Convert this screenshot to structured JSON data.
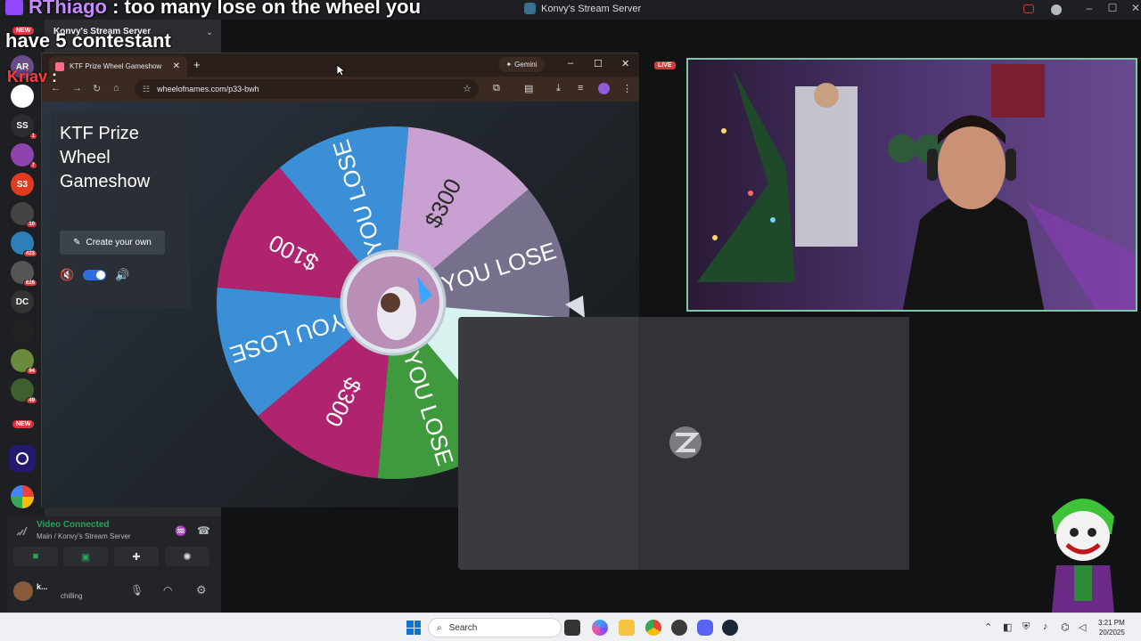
{
  "chat": {
    "username": "RThiago",
    "message_line1": " : too many lose on the wheel you",
    "message_line2": "have 5 contestant",
    "next_username": "Kriav",
    "next_separator": ":"
  },
  "discord": {
    "window_title": "Konvy's Stream Server",
    "server_header": "Konvy's Stream Server",
    "new_badge": "NEW",
    "guilds": [
      {
        "label": "AR",
        "badge": "",
        "color": "#6b4c8a"
      },
      {
        "label": "",
        "badge": "",
        "color": "#ffffff"
      },
      {
        "label": "SS",
        "badge": "1",
        "color": "#2b2d31"
      },
      {
        "label": "",
        "badge": "7",
        "color": "#8e44ad"
      },
      {
        "label": "S3",
        "badge": "",
        "color": "#e03b1f"
      },
      {
        "label": "",
        "badge": "10",
        "color": "#444"
      },
      {
        "label": "",
        "badge": "423",
        "color": "#2c7fb8"
      },
      {
        "label": "",
        "badge": "626",
        "color": "#555"
      },
      {
        "label": "DC",
        "badge": "",
        "color": "#333"
      },
      {
        "label": "",
        "badge": "",
        "color": "#222"
      },
      {
        "label": "",
        "badge": "94",
        "color": "#6a8b3c"
      },
      {
        "label": "",
        "badge": "49",
        "color": "#3f5f2e"
      }
    ],
    "voice": {
      "status": "Video Connected",
      "channel": "Main / Konvy's Stream Server"
    },
    "user": {
      "name": "k...",
      "status": "chilling"
    }
  },
  "browser": {
    "tab_title": "KTF Prize Wheel Gameshow",
    "gemini_label": "Gemini",
    "url": "wheelofnames.com/p33-bwh"
  },
  "wheel_page": {
    "title": "KTF Prize Wheel Gameshow",
    "create_button": "Create your own",
    "segments": [
      "$300",
      "YOU LOSE",
      "$100",
      "YOU LOSE",
      "$300",
      "YOU LOSE",
      "$100",
      "YOU LOSE"
    ]
  },
  "stream": {
    "live_badge": "LIVE"
  },
  "taskbar": {
    "search_placeholder": "Search",
    "time": "3:21 PM",
    "date": "20/2025"
  },
  "colors": {
    "seg_pink_light": "#c9a0d2",
    "seg_slate": "#76708c",
    "seg_mint": "#d8f3ef",
    "seg_green": "#3f9a3e",
    "seg_magenta": "#b0246f",
    "seg_blue": "#3a8fd6"
  }
}
